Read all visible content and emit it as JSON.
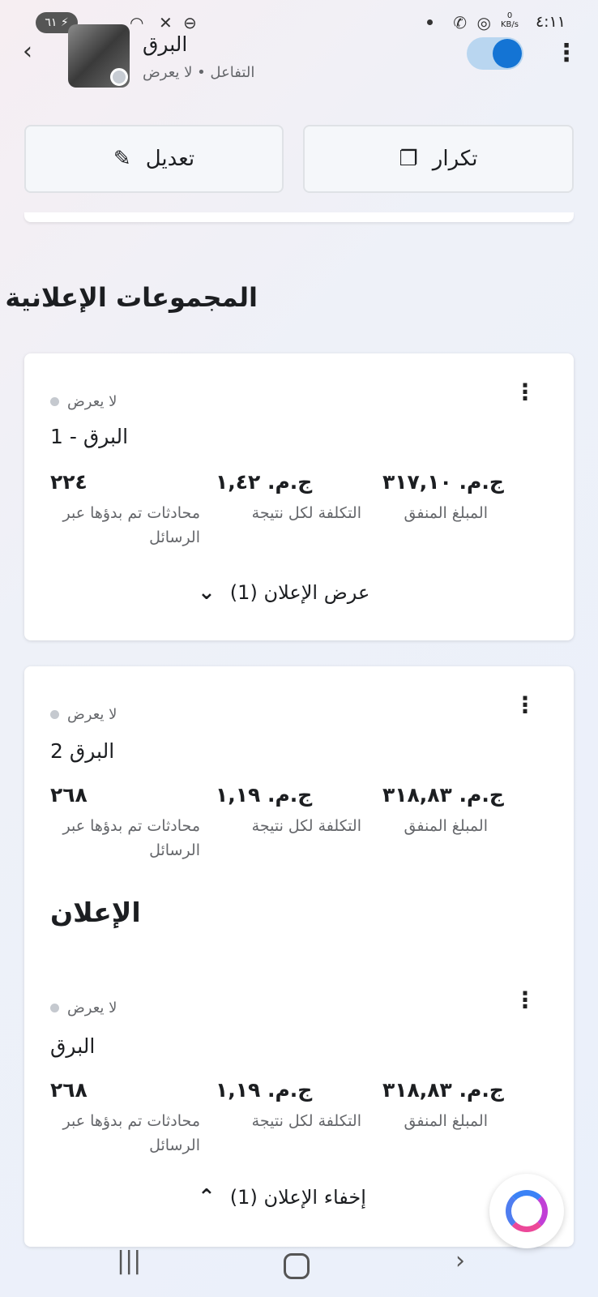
{
  "status_bar": {
    "time": "٤:١١",
    "net_speed_value": "0",
    "net_speed_unit": "KB/s",
    "battery": "٦١"
  },
  "header": {
    "title": "البرق",
    "subtitle": "التفاعل • لا يعرض",
    "toggle_on": true
  },
  "actions": {
    "duplicate_label": "تكرار",
    "edit_label": "تعديل"
  },
  "section": {
    "title": "المجموعات الإعلانية"
  },
  "ad_sets": [
    {
      "status": "لا يعرض",
      "name": "البرق - 1",
      "metrics": {
        "spent_value": "ج.م. ٣١٧,١٠",
        "spent_label": "المبلغ المنفق",
        "cost_value": "ج.م. ١,٤٢",
        "cost_label": "التكلفة لكل نتيجة",
        "conv_value": "٢٢٤",
        "conv_label": "محادثات تم بدؤها عبر الرسائل"
      },
      "toggle_label": "عرض الإعلان (1)"
    },
    {
      "status": "لا يعرض",
      "name": "البرق 2",
      "metrics": {
        "spent_value": "ج.م. ٣١٨,٨٣",
        "spent_label": "المبلغ المنفق",
        "cost_value": "ج.م. ١,١٩",
        "cost_label": "التكلفة لكل نتيجة",
        "conv_value": "٢٦٨",
        "conv_label": "محادثات تم بدؤها عبر الرسائل"
      },
      "ads_heading": "الإعلان",
      "ad": {
        "status": "لا يعرض",
        "name": "البرق",
        "metrics": {
          "spent_value": "ج.م. ٣١٨,٨٣",
          "spent_label": "المبلغ المنفق",
          "cost_value": "ج.م. ١,١٩",
          "cost_label": "التكلفة لكل نتيجة",
          "conv_value": "٢٦٨",
          "conv_label": "محادثات تم بدؤها عبر الرسائل"
        }
      },
      "toggle_label": "إخفاء الإعلان (1)"
    }
  ]
}
